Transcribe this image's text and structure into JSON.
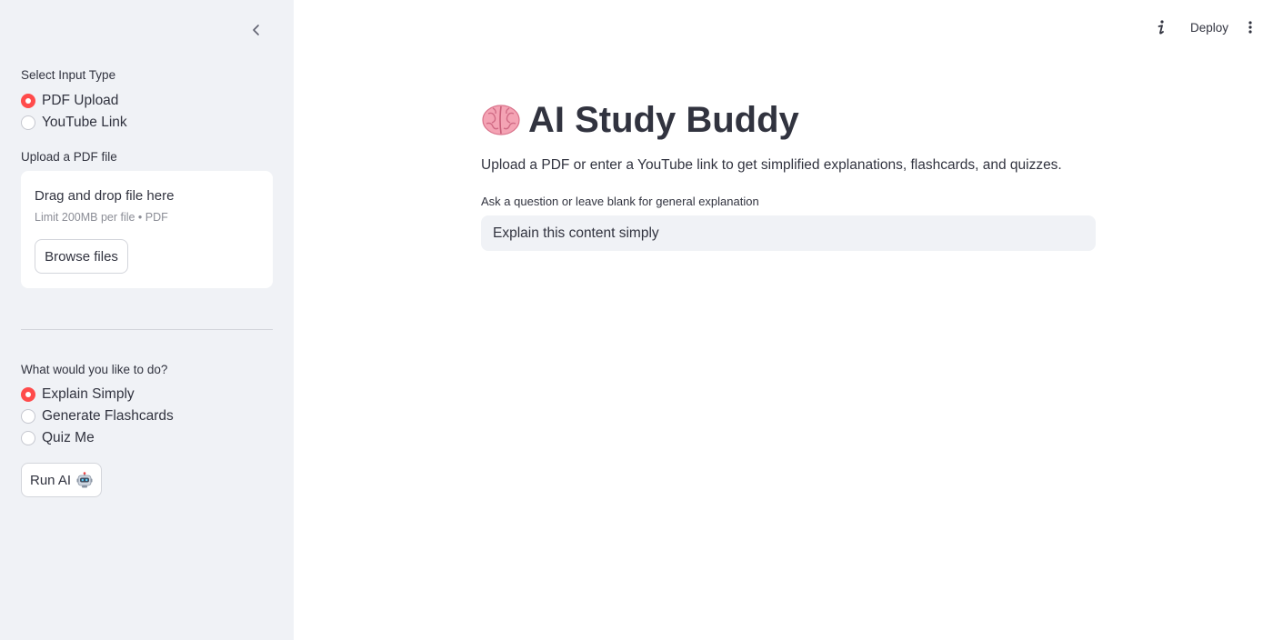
{
  "sidebar": {
    "input_type": {
      "label": "Select Input Type",
      "options": [
        {
          "label": "PDF Upload",
          "selected": true
        },
        {
          "label": "YouTube Link",
          "selected": false
        }
      ]
    },
    "upload": {
      "label": "Upload a PDF file",
      "drop_title": "Drag and drop file here",
      "limit_text": "Limit 200MB per file • PDF",
      "browse_label": "Browse files"
    },
    "action": {
      "label": "What would you like to do?",
      "options": [
        {
          "label": "Explain Simply",
          "selected": true
        },
        {
          "label": "Generate Flashcards",
          "selected": false
        },
        {
          "label": "Quiz Me",
          "selected": false
        }
      ]
    },
    "run_label": "Run AI",
    "run_icon": "robot-icon"
  },
  "header": {
    "deploy_label": "Deploy",
    "icons": [
      "info-icon",
      "more-vertical-icon"
    ]
  },
  "main": {
    "title": "AI Study Buddy",
    "title_icon": "brain-icon",
    "description": "Upload a PDF or enter a YouTube link to get simplified explanations, flashcards, and quizzes.",
    "question_label": "Ask a question or leave blank for general explanation",
    "question_value": "Explain this content simply"
  },
  "colors": {
    "accent": "#ff4b4b",
    "sidebar_bg": "#f0f2f6",
    "text": "#31333f",
    "muted": "#8b8d96"
  }
}
